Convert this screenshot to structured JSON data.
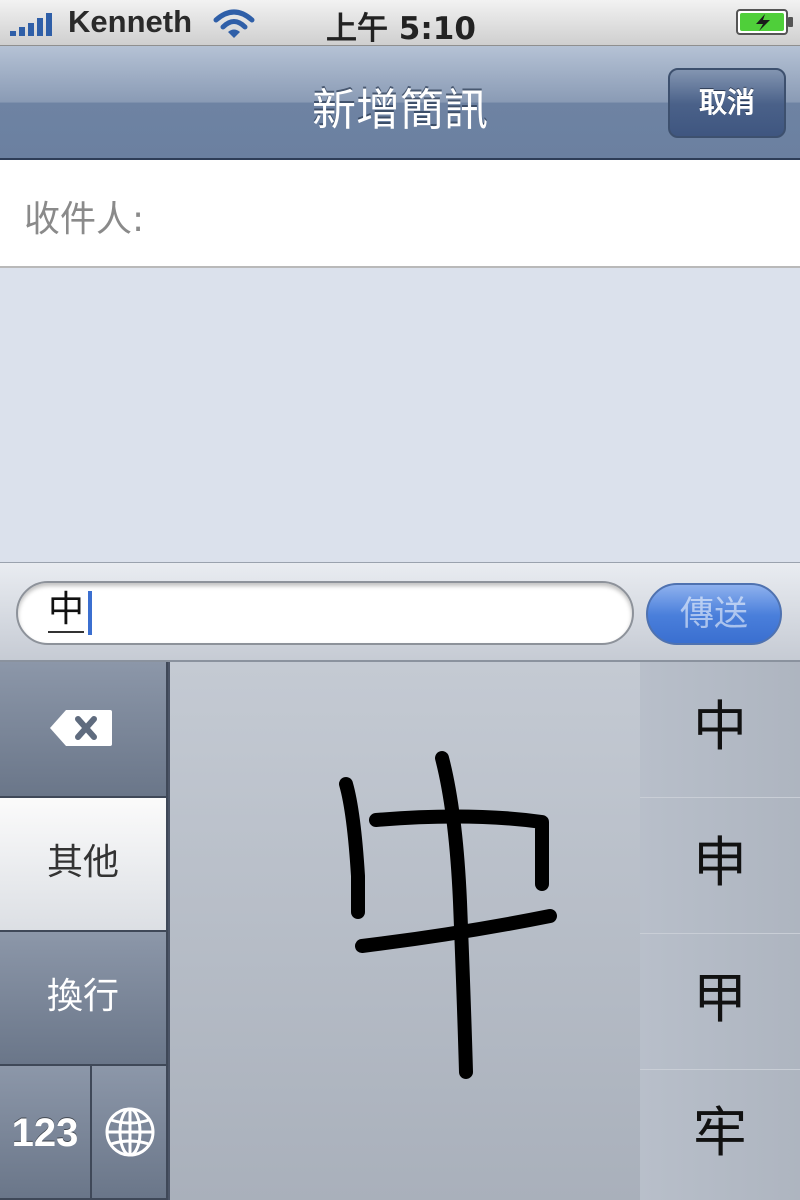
{
  "status_bar": {
    "carrier": "Kenneth",
    "time": "上午 5:10",
    "signal_icon": "signal-bars-icon",
    "wifi_icon": "wifi-icon",
    "battery_icon": "battery-charging-icon"
  },
  "nav": {
    "title": "新增簡訊",
    "cancel_label": "取消"
  },
  "recipient": {
    "label": "收件人:"
  },
  "compose": {
    "message_value": "中",
    "send_label": "傳送"
  },
  "keyboard": {
    "delete_icon": "delete-backspace-icon",
    "other_label": "其他",
    "return_label": "換行",
    "numbers_label": "123",
    "globe_icon": "globe-icon",
    "candidates": [
      "中",
      "申",
      "甲",
      "牢"
    ]
  },
  "colors": {
    "nav_bar": "#7f92af",
    "send_button": "#4a7fdb",
    "conversation_bg": "#dbe1ec",
    "keyboard_side": "#6a7689"
  }
}
